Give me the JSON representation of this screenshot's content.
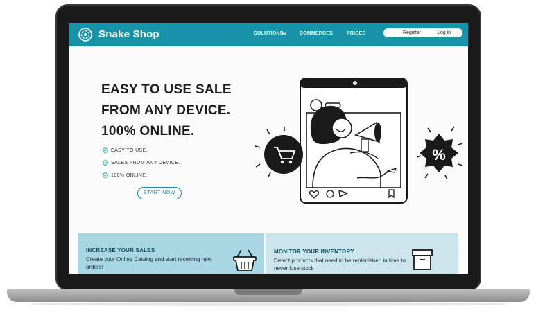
{
  "brand": {
    "name": "Snake Shop"
  },
  "nav": {
    "solutions": "SOLUTIONS",
    "commerces": "COMMERCES",
    "prices": "PRICES",
    "register": "Register",
    "login": "Log in"
  },
  "hero": {
    "line1": "EASY TO USE SALE",
    "line2": "FROM ANY DEVICE.",
    "line3": "100% ONLINE.",
    "features": [
      "EASY TO USE.",
      "SALES FROM ANY DEVICE.",
      "100% ONLINE."
    ],
    "cta": "START NOW"
  },
  "cards": [
    {
      "title": "INCREASE YOUR SALES",
      "text": "Create your Online Catalog and start receiving new orders!",
      "icon": "shopping-basket-icon"
    },
    {
      "title": "MONITOR YOUR INVENTORY",
      "text": "Detect products that need to be replenished in time to never lose stock",
      "icon": "box-icon"
    }
  ],
  "illustration": {
    "badge_symbol": "%"
  },
  "colors": {
    "brand": "#1993a8",
    "card1": "#a8d6e3",
    "card2": "#cbe5ec"
  }
}
